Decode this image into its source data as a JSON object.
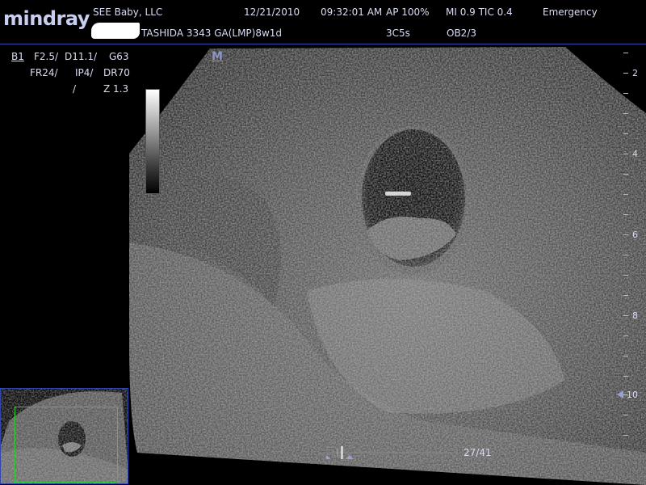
{
  "header": {
    "brand": "mindray",
    "institution": "SEE Baby, LLC",
    "date": "12/21/2010",
    "time": "09:32:01 AM",
    "acoustic_power": "AP  100%",
    "mi_tic": "MI 0.9 TIC 0.4",
    "mode": "Emergency",
    "patient": "TASHIDA 3343 GA(LMP)8w1d",
    "probe": "3C5s",
    "exam": "OB2/3"
  },
  "params": {
    "b_mode": "B1",
    "freq": "F2.5/",
    "depth": "D11.1/",
    "gain": "G63",
    "frame_rate": "FR24/",
    "image_proc": "IP4/",
    "dynamic_range": "DR70",
    "slash": "/",
    "zoom": "Z 1.3",
    "m_marker": "M"
  },
  "depth_scale": {
    "labels": [
      "2",
      "4",
      "6",
      "8",
      "10"
    ]
  },
  "cine": {
    "frame": "27/41",
    "current": 27,
    "total": 41
  },
  "colors": {
    "text": "#d8dcf2",
    "header_line": "#3a4ab0",
    "roi_box": "#33cc33",
    "thumb_border": "#2f45b0"
  }
}
